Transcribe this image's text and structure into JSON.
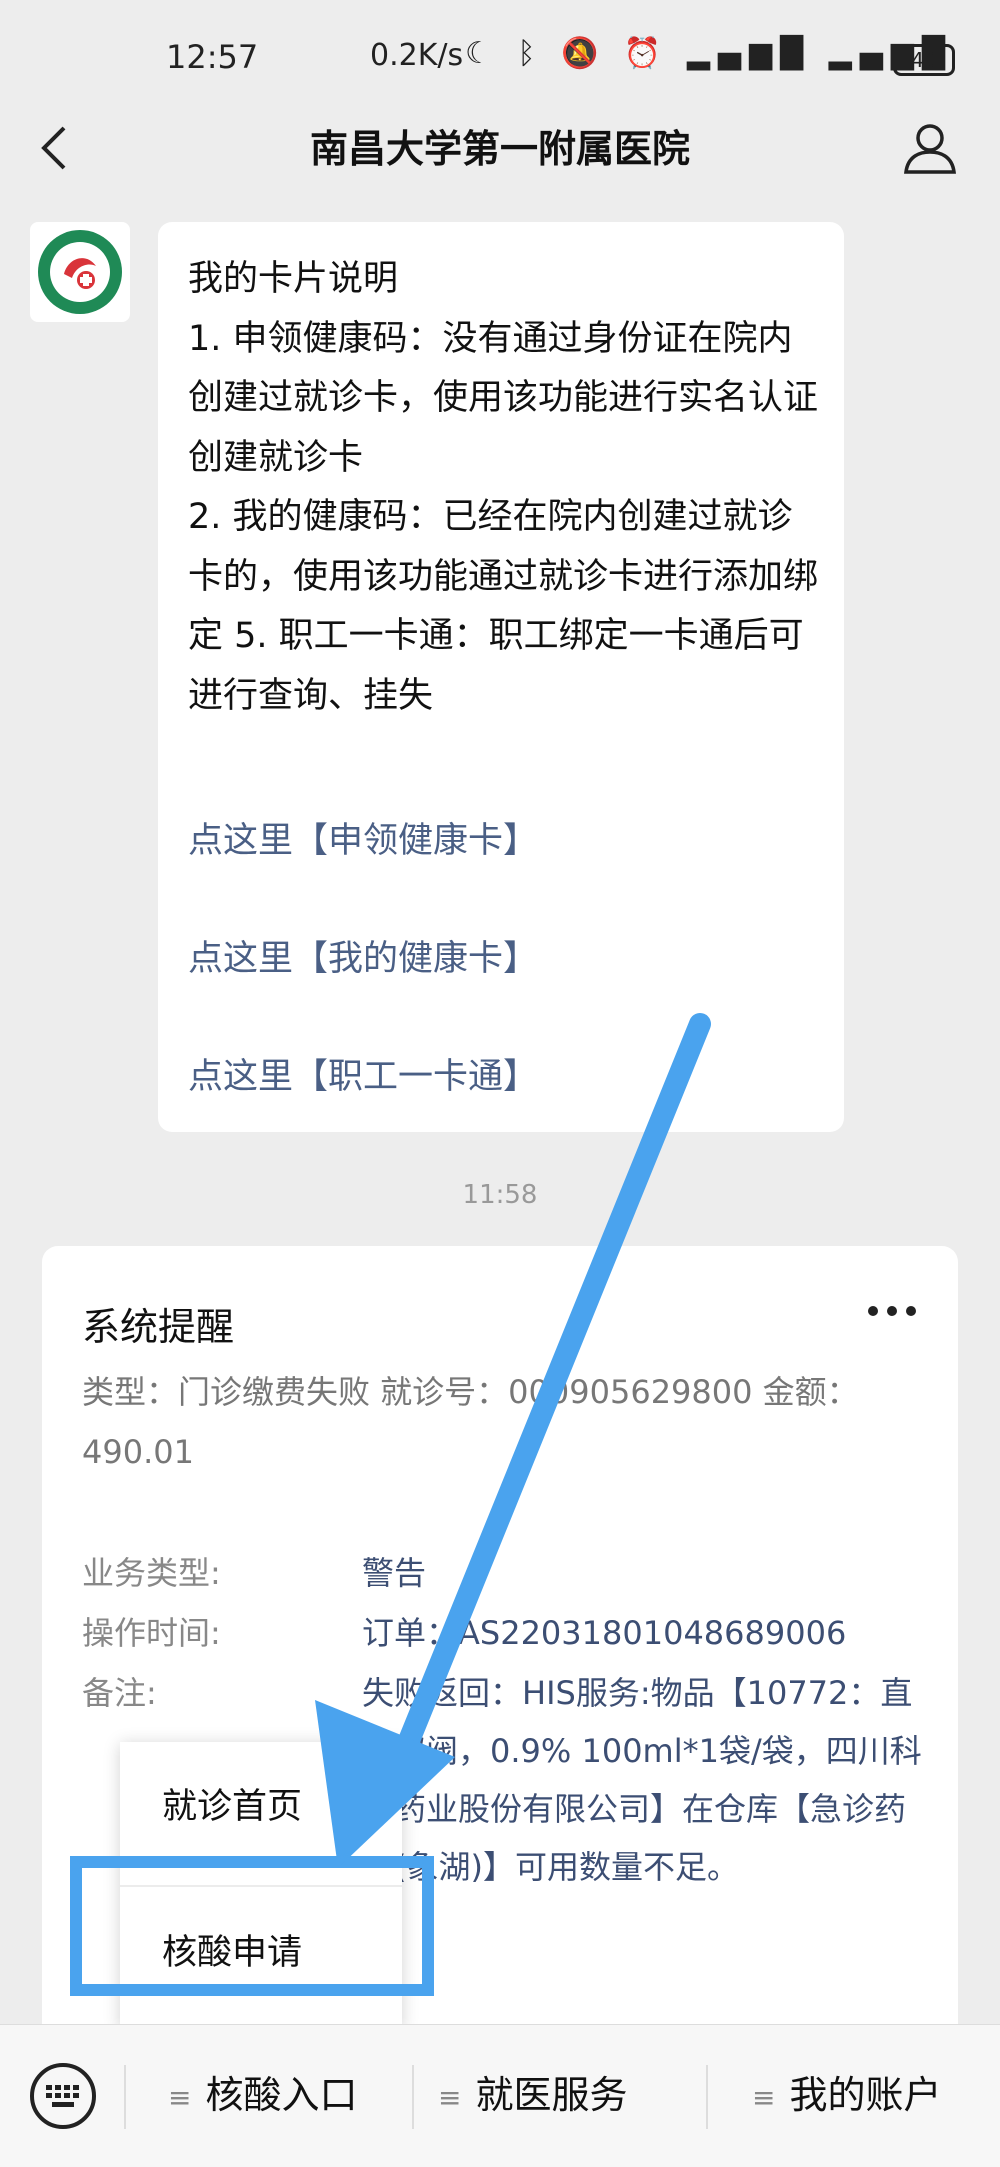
{
  "status_bar": {
    "time": "12:57",
    "net_speed": "0.2K/s",
    "battery": "40",
    "icons": [
      "moon-icon",
      "bluetooth-icon",
      "mute-icon",
      "alarm-icon",
      "hd-icon",
      "signal-5g-icon",
      "hd-icon",
      "signal-4g-icon"
    ]
  },
  "header": {
    "title": "南昌大学第一附属医院",
    "back_icon": "back-icon",
    "user_icon": "user-icon"
  },
  "chat": {
    "bubble_text": "我的卡片说明\n1. 申领健康码：没有通过身份证在院内创建过就诊卡，使用该功能进行实名认证创建就诊卡\n2. 我的健康码：已经在院内创建过就诊卡的，使用该功能通过就诊卡进行添加绑定 5. 职工一卡通：职工绑定一卡通后可进行查询、挂失",
    "links": [
      "点这里【申领健康卡】",
      "点这里【我的健康卡】",
      "点这里【职工一卡通】"
    ],
    "timestamp": "11:58"
  },
  "card": {
    "title": "系统提醒",
    "summary": "类型：门诊缴费失败 就诊号：000905629800 金额：490.01",
    "fields": [
      {
        "label": "业务类型:",
        "value": "警告"
      },
      {
        "label": "操作时间:",
        "value": "订单：AS22031801048689006"
      },
      {
        "label": "备注:",
        "value": "失败返回：HIS服务:物品【10772：直立双阀，0.9% 100ml*1袋/袋，四川科伦药业股份有限公司】在仓库【急诊药房(象湖)】可用数量不足。"
      }
    ]
  },
  "popup_menu": {
    "items": [
      "就诊首页",
      "核酸申请"
    ]
  },
  "tab_bar": {
    "tabs": [
      "核酸入口",
      "就医服务",
      "我的账户"
    ]
  },
  "colors": {
    "highlight": "#4aa3ee",
    "link": "#4a5f85",
    "background": "#ededed"
  }
}
